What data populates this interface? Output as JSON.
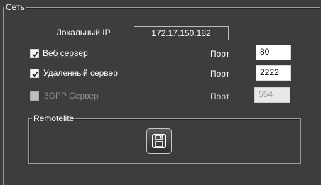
{
  "network": {
    "legend": "Сеть",
    "local_ip_label": "Локальный IP",
    "local_ip_value": "172.17.150.182"
  },
  "servers": [
    {
      "label": "Веб сервер",
      "checked": true,
      "enabled": true,
      "port_label": "Порт",
      "port_value": "80"
    },
    {
      "label": "Удаленный сервер",
      "checked": true,
      "enabled": true,
      "port_label": "Порт",
      "port_value": "2222"
    },
    {
      "label": "3GPP Сервер",
      "checked": false,
      "enabled": false,
      "port_label": "Порт",
      "port_value": "554"
    }
  ],
  "remotelite": {
    "legend": "Remotelite",
    "save_icon": "floppy-disk-icon"
  }
}
